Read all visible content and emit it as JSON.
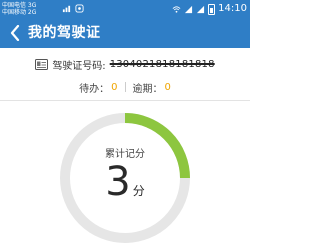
{
  "status_bar": {
    "carrier1": "中国电信 3G",
    "carrier2": "中国移动 2G",
    "time": "14:10"
  },
  "header": {
    "title": "我的驾驶证"
  },
  "license": {
    "label": "驾驶证号码:",
    "number": "1304021818181818"
  },
  "status": {
    "pending_label": "待办：",
    "pending_value": "0",
    "overdue_label": "逾期：",
    "overdue_value": "0"
  },
  "score": {
    "label": "累计记分",
    "value": "3",
    "unit": "分",
    "fraction_of_max": 0.25
  },
  "colors": {
    "primary": "#2f7ec6",
    "accent_green": "#8dc63f",
    "ring_gray": "#e6e6e6",
    "counter_orange": "#f0a500"
  }
}
